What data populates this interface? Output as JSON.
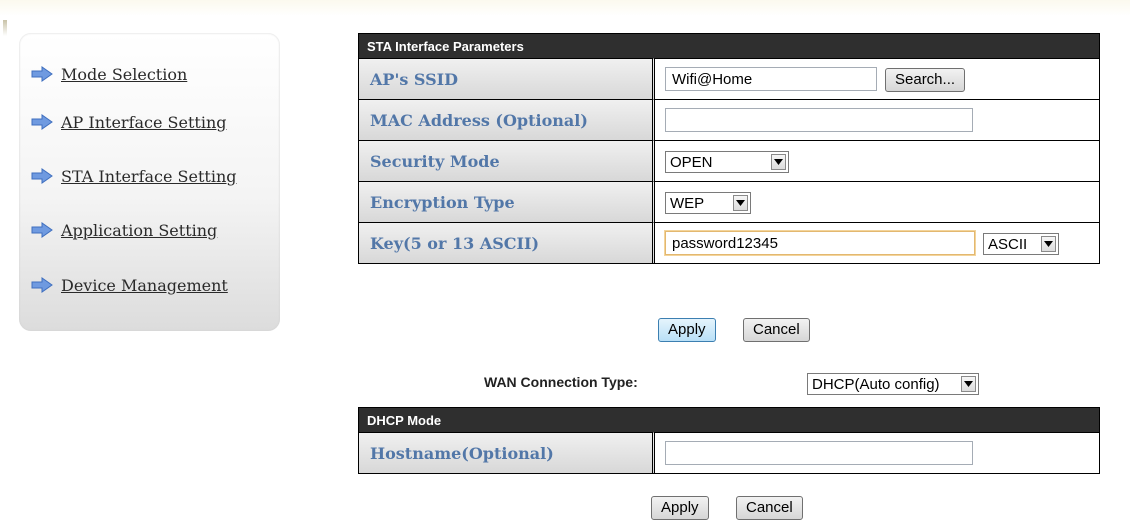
{
  "sidebar": {
    "items": [
      {
        "label": "Mode Selection",
        "icon": "arrow-right-icon"
      },
      {
        "label": "AP Interface Setting",
        "icon": "arrow-right-icon"
      },
      {
        "label": "STA Interface Setting",
        "icon": "arrow-right-icon"
      },
      {
        "label": "Application Setting",
        "icon": "arrow-right-icon"
      },
      {
        "label": "Device Management",
        "icon": "arrow-right-icon"
      }
    ]
  },
  "sta": {
    "header": "STA Interface Parameters",
    "ssid_label": "AP's SSID",
    "ssid_value": "Wifi@Home",
    "search_label": "Search...",
    "mac_label": "MAC Address (Optional)",
    "mac_value": "",
    "security_label": "Security Mode",
    "security_value": "OPEN",
    "encryption_label": "Encryption Type",
    "encryption_value": "WEP",
    "key_label": "Key(5 or 13 ASCII)",
    "key_value": "password12345",
    "key_format": "ASCII",
    "apply_label": "Apply",
    "cancel_label": "Cancel"
  },
  "wan": {
    "label": "WAN Connection Type:",
    "value": "DHCP(Auto config)"
  },
  "dhcp": {
    "header": "DHCP Mode",
    "hostname_label": "Hostname(Optional)",
    "hostname_value": "",
    "apply_label": "Apply",
    "cancel_label": "Cancel"
  },
  "colors": {
    "header_bg": "#2f2f2f",
    "label_text": "#5277a8",
    "arrow_fill": "#6f9ae0"
  }
}
